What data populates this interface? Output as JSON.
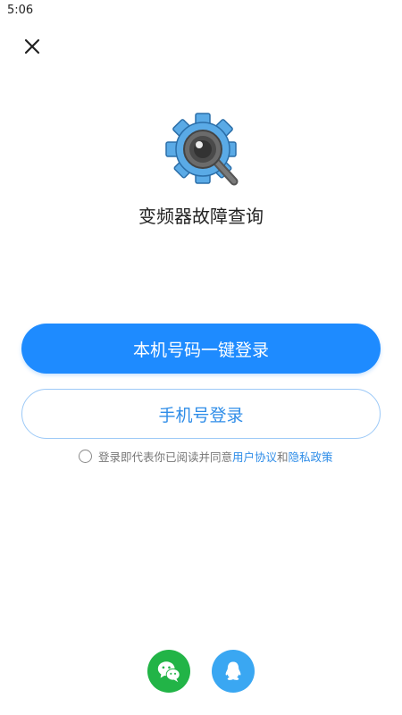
{
  "status": {
    "time": "5:06"
  },
  "app": {
    "title": "变频器故障查询"
  },
  "buttons": {
    "one_click_login": "本机号码一键登录",
    "phone_login": "手机号登录"
  },
  "agreement": {
    "prefix": "登录即代表你已阅读并同意",
    "user_agreement": "用户协议",
    "conjunction": "和",
    "privacy_policy": "隐私政策",
    "checked": false
  },
  "icons": {
    "close": "close-icon",
    "logo": "gear-magnifier-icon",
    "wechat": "wechat-icon",
    "qq": "qq-icon"
  },
  "colors": {
    "primary": "#1e8bff",
    "link": "#2f8de8",
    "wechat": "#22b447",
    "qq": "#3aa7f2"
  }
}
